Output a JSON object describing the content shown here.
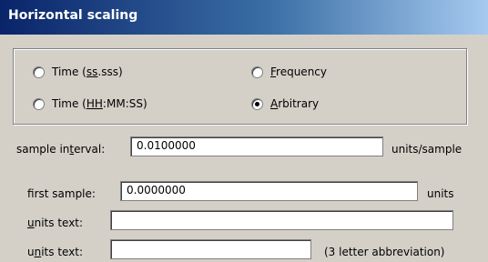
{
  "window": {
    "title": "Horizontal scaling"
  },
  "group": {
    "options": [
      {
        "prefix": "Time (",
        "accel": "ss",
        "suffix": ".sss)",
        "checked": false
      },
      {
        "prefix": "Time (",
        "accel": "HH",
        "suffix": ":MM:SS)",
        "checked": false
      },
      {
        "prefix": "",
        "accel": "F",
        "suffix": "requency",
        "checked": false
      },
      {
        "prefix": "",
        "accel": "A",
        "suffix": "rbitrary",
        "checked": true
      }
    ]
  },
  "sample_interval": {
    "label_prefix": "sample in",
    "label_accel": "t",
    "label_suffix": "erval:",
    "value": "0.0100000",
    "unit": "units/sample"
  },
  "first_sample": {
    "label_prefix": "f",
    "label_accel": "i",
    "label_suffix": "rst sample:",
    "value": "0.0000000",
    "unit": "units"
  },
  "units_text_1": {
    "label_accel": "u",
    "label_suffix": "nits text:",
    "value": ""
  },
  "units_text_2": {
    "label_prefix": "u",
    "label_accel": "n",
    "label_suffix": "its text:",
    "value": "",
    "hint": "(3 letter abbreviation)"
  }
}
